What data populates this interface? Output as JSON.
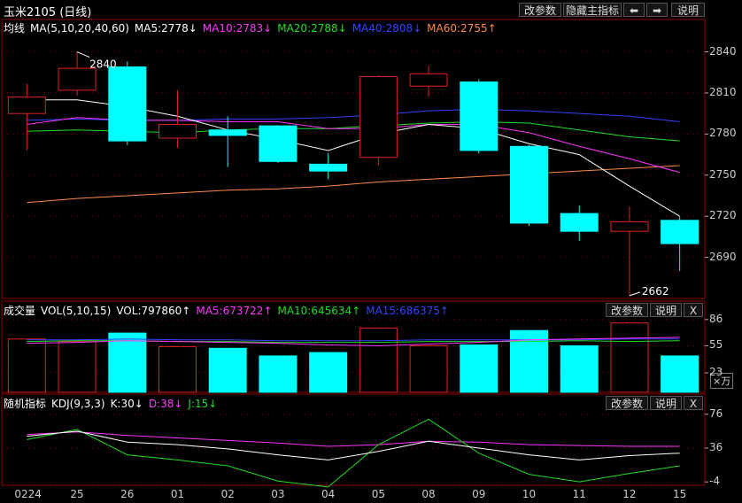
{
  "title": "玉米2105 (日线)",
  "toolbar": {
    "modify": "改参数",
    "hide": "隐藏主指标",
    "prev": "⬅",
    "next": "➡",
    "help": "说明"
  },
  "main_header": {
    "label": "均线",
    "params": "MA(5,10,20,40,60)",
    "ma5": "MA5:2778↓",
    "ma10": "MA10:2783↓",
    "ma20": "MA20:2788↓",
    "ma40": "MA40:2808↓",
    "ma60": "MA60:2755↑"
  },
  "vol_header": {
    "label": "成交量",
    "params": "VOL(5,10,15)",
    "vol": "VOL:797860↑",
    "ma5": "MA5:673722↑",
    "ma10": "MA10:645634↑",
    "ma15": "MA15:686375↑"
  },
  "kdj_header": {
    "label": "随机指标",
    "params": "KDJ(9,3,3)",
    "k": "K:30↓",
    "d": "D:38↓",
    "j": "J:15↓"
  },
  "pane_buttons": {
    "modify": "改参数",
    "help": "说明",
    "close": "X"
  },
  "vol_unit": "×万",
  "annotations": {
    "high": "2840",
    "low": "2662"
  },
  "colors": {
    "up": "#e02020",
    "down": "#00ffff",
    "ma5": "#ffffff",
    "ma10": "#ff33ff",
    "ma20": "#22dd22",
    "ma40": "#3344ff",
    "ma60": "#ff8844",
    "grid": "#8b0000"
  },
  "chart_data": [
    {
      "type": "candlestick",
      "title": "玉米2105 (日线)",
      "x": [
        "0224",
        "25",
        "26",
        "01",
        "02",
        "03",
        "04",
        "05",
        "08",
        "09",
        "10",
        "11",
        "12",
        "15"
      ],
      "ohlc": [
        [
          2795,
          2817,
          2768,
          2807
        ],
        [
          2812,
          2840,
          2808,
          2828
        ],
        [
          2829,
          2833,
          2772,
          2775
        ],
        [
          2777,
          2812,
          2770,
          2787
        ],
        [
          2783,
          2793,
          2756,
          2779
        ],
        [
          2786,
          2786,
          2759,
          2760
        ],
        [
          2758,
          2766,
          2747,
          2753
        ],
        [
          2763,
          2823,
          2757,
          2822
        ],
        [
          2815,
          2830,
          2807,
          2824
        ],
        [
          2818,
          2820,
          2766,
          2768
        ],
        [
          2771,
          2772,
          2713,
          2715
        ],
        [
          2722,
          2728,
          2702,
          2709
        ],
        [
          2709,
          2727,
          2662,
          2716
        ],
        [
          2717,
          2720,
          2680,
          2700
        ]
      ],
      "ma5": [
        2805,
        2805,
        2800,
        2793,
        2783,
        2776,
        2768,
        2780,
        2787,
        2784,
        2773,
        2765,
        2742,
        2720
      ],
      "ma10": [
        2787,
        2792,
        2790,
        2790,
        2789,
        2789,
        2784,
        2784,
        2787,
        2787,
        2781,
        2771,
        2762,
        2752
      ],
      "ma20": [
        2782,
        2783,
        2782,
        2781,
        2783,
        2784,
        2784,
        2786,
        2788,
        2789,
        2788,
        2783,
        2778,
        2775
      ],
      "ma40": [
        2790,
        2791,
        2790,
        2790,
        2791,
        2791,
        2792,
        2794,
        2797,
        2798,
        2797,
        2795,
        2793,
        2789
      ],
      "ma60": [
        2730,
        2733,
        2735,
        2737,
        2739,
        2740,
        2742,
        2745,
        2747,
        2749,
        2751,
        2753,
        2755,
        2757
      ],
      "ylim": [
        2660,
        2852
      ],
      "yticks": [
        2690,
        2720,
        2750,
        2780,
        2810,
        2840
      ]
    },
    {
      "type": "bar",
      "title": "成交量",
      "values": [
        63,
        60,
        70,
        54,
        52,
        43,
        47,
        76,
        55,
        56,
        73,
        55,
        82,
        43
      ],
      "direction": [
        "up",
        "up",
        "down",
        "up",
        "down",
        "down",
        "down",
        "up",
        "up",
        "down",
        "down",
        "down",
        "up",
        "down"
      ],
      "ma5": [
        58,
        59,
        61,
        60,
        59,
        58,
        56,
        55,
        57,
        59,
        62,
        63,
        64,
        65
      ],
      "ma10": [
        60,
        61,
        61,
        60,
        60,
        59,
        59,
        59,
        60,
        60,
        60,
        61,
        60,
        61
      ],
      "ma15": [
        62,
        62,
        63,
        62,
        62,
        61,
        61,
        61,
        62,
        62,
        62,
        62,
        63,
        63
      ],
      "ylim": [
        0,
        90
      ],
      "yticks": [
        23,
        55,
        86
      ]
    },
    {
      "type": "line",
      "title": "KDJ",
      "k": [
        50,
        56,
        43,
        40,
        35,
        28,
        22,
        32,
        44,
        36,
        28,
        22,
        27,
        30
      ],
      "d": [
        52,
        55,
        51,
        48,
        45,
        42,
        38,
        40,
        44,
        43,
        40,
        39,
        38,
        38
      ],
      "j": [
        46,
        58,
        28,
        22,
        15,
        -3,
        -10,
        40,
        70,
        30,
        5,
        -4,
        6,
        15
      ],
      "ylim": [
        -8,
        82
      ],
      "yticks": [
        -4,
        36,
        76
      ]
    }
  ]
}
